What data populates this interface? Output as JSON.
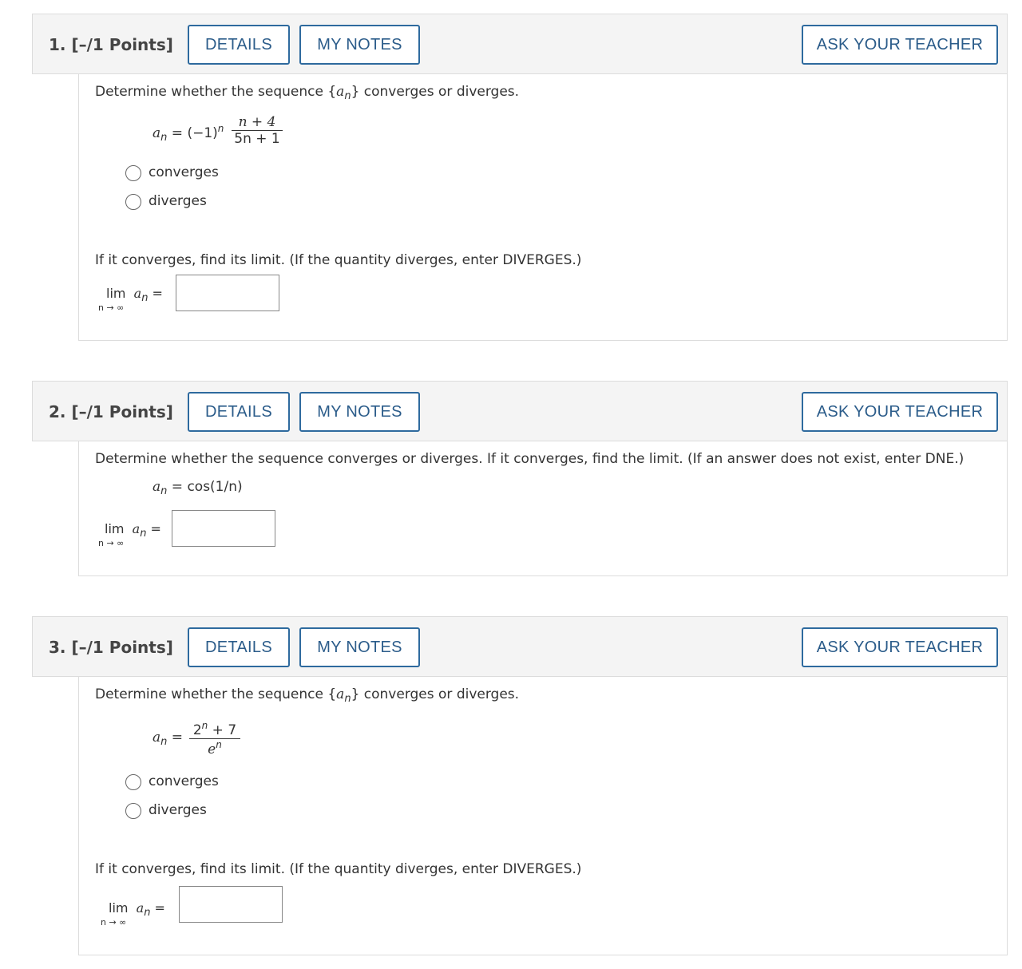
{
  "buttons": {
    "details": "DETAILS",
    "my_notes": "MY NOTES",
    "ask_teacher": "ASK YOUR TEACHER"
  },
  "q1": {
    "number": "1.  [–/1 Points]",
    "prompt_pre": "Determine whether the sequence {",
    "prompt_var": "a",
    "prompt_sub": "n",
    "prompt_post": "} converges or diverges.",
    "formula_lhs": "a",
    "formula_lhs_sub": "n",
    "formula_eq": "= (−1)",
    "formula_power": "n",
    "numerator": "n + 4",
    "denominator": "5n + 1",
    "option1": "converges",
    "option2": "diverges",
    "limit_prompt": "If it converges, find its limit. (If the quantity diverges, enter DIVERGES.)",
    "lim": "lim",
    "lim_var": "a",
    "lim_var_sub": "n",
    "lim_eq": "=",
    "lim_under": "n → ∞"
  },
  "q2": {
    "number": "2.  [–/1 Points]",
    "prompt": "Determine whether the sequence converges or diverges. If it converges, find the limit. (If an answer does not exist, enter DNE.)",
    "formula_lhs": "a",
    "formula_lhs_sub": "n",
    "formula_rhs": "= cos(1/n)",
    "lim": "lim",
    "lim_var": "a",
    "lim_var_sub": "n",
    "lim_eq": "=",
    "lim_under": "n → ∞"
  },
  "q3": {
    "number": "3.  [–/1 Points]",
    "prompt_pre": "Determine whether the sequence {",
    "prompt_var": "a",
    "prompt_sub": "n",
    "prompt_post": "} converges or diverges.",
    "formula_lhs": "a",
    "formula_lhs_sub": "n",
    "formula_eq": "=",
    "numerator_base": "2",
    "numerator_power": "n",
    "numerator_rest": " + 7",
    "denominator_base": "e",
    "denominator_power": "n",
    "option1": "converges",
    "option2": "diverges",
    "limit_prompt": "If it converges, find its limit. (If the quantity diverges, enter DIVERGES.)",
    "lim": "lim",
    "lim_var": "a",
    "lim_var_sub": "n",
    "lim_eq": "=",
    "lim_under": "n → ∞"
  }
}
